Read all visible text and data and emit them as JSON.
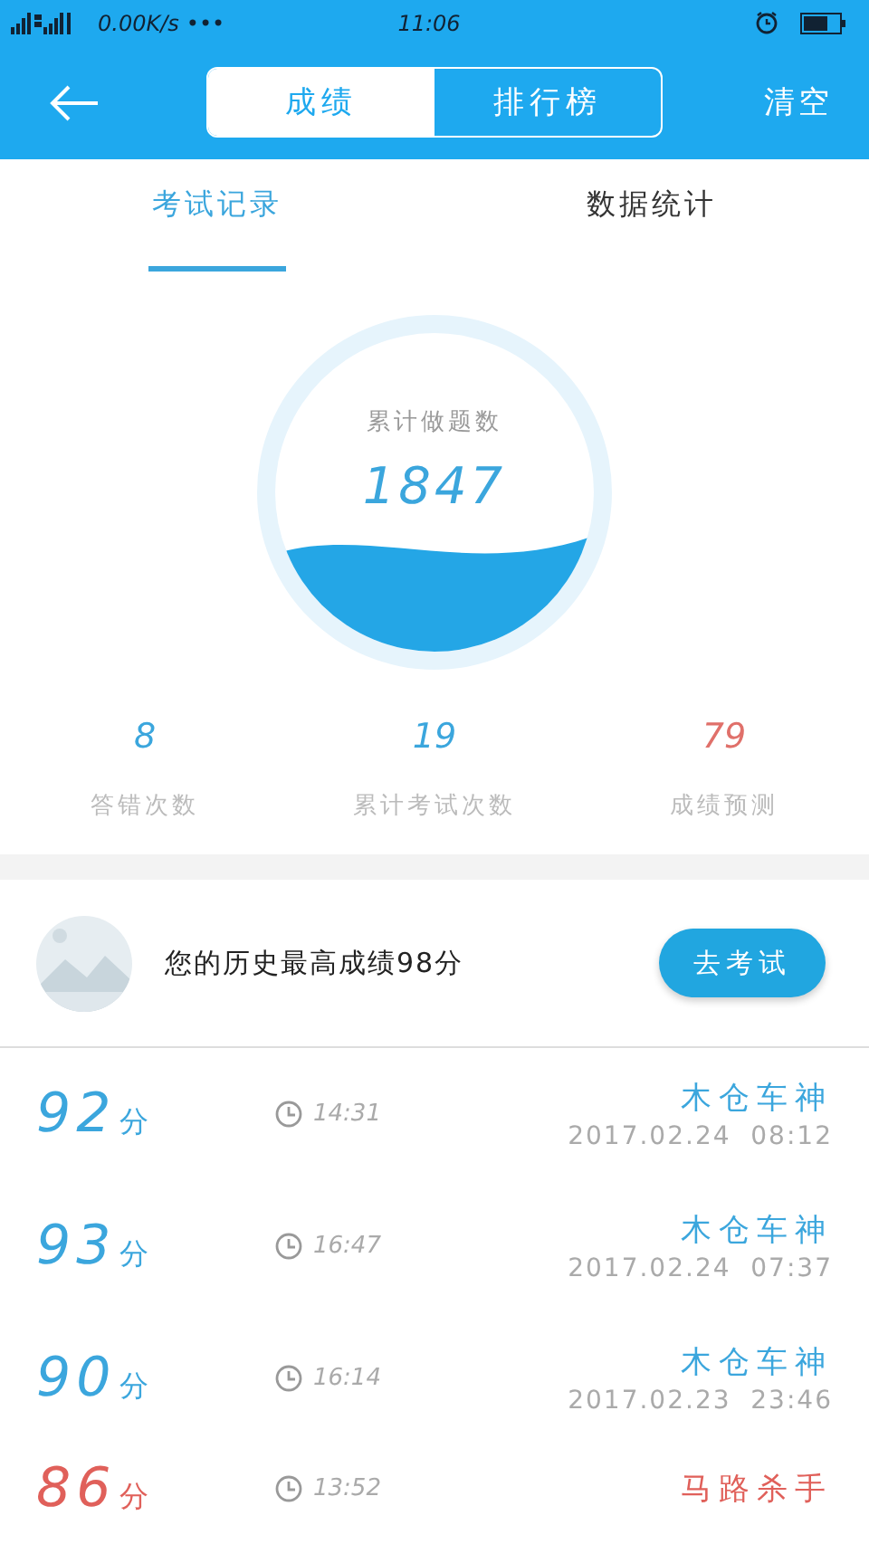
{
  "status_bar": {
    "network": "0.00K/s",
    "dots": "•••",
    "time": "11:06"
  },
  "header": {
    "segments": [
      {
        "label": "成绩",
        "selected": true
      },
      {
        "label": "排行榜",
        "selected": false
      }
    ],
    "action": "清空"
  },
  "sub_tabs": [
    {
      "label": "考试记录",
      "selected": true
    },
    {
      "label": "数据统计",
      "selected": false
    }
  ],
  "gauge": {
    "label": "累计做题数",
    "value": "1847"
  },
  "stats": [
    {
      "value": "8",
      "label": "答错次数",
      "color": "#3ba6dd"
    },
    {
      "value": "19",
      "label": "累计考试次数",
      "color": "#3ba6dd"
    },
    {
      "value": "79",
      "label": "成绩预测",
      "color": "#e0706a"
    }
  ],
  "best": {
    "text": "您的历史最高成绩98分",
    "button": "去考试"
  },
  "records": [
    {
      "score": "92",
      "unit": "分",
      "duration": "14:31",
      "title": "木仓车神",
      "date": "2017.02.24  08:12",
      "color": "#3ba6dd"
    },
    {
      "score": "93",
      "unit": "分",
      "duration": "16:47",
      "title": "木仓车神",
      "date": "2017.02.24  07:37",
      "color": "#3ba6dd"
    },
    {
      "score": "90",
      "unit": "分",
      "duration": "16:14",
      "title": "木仓车神",
      "date": "2017.02.23  23:46",
      "color": "#3ba6dd"
    },
    {
      "score": "86",
      "unit": "分",
      "duration": "13:52",
      "title": "马路杀手",
      "color": "#e0605a"
    }
  ]
}
